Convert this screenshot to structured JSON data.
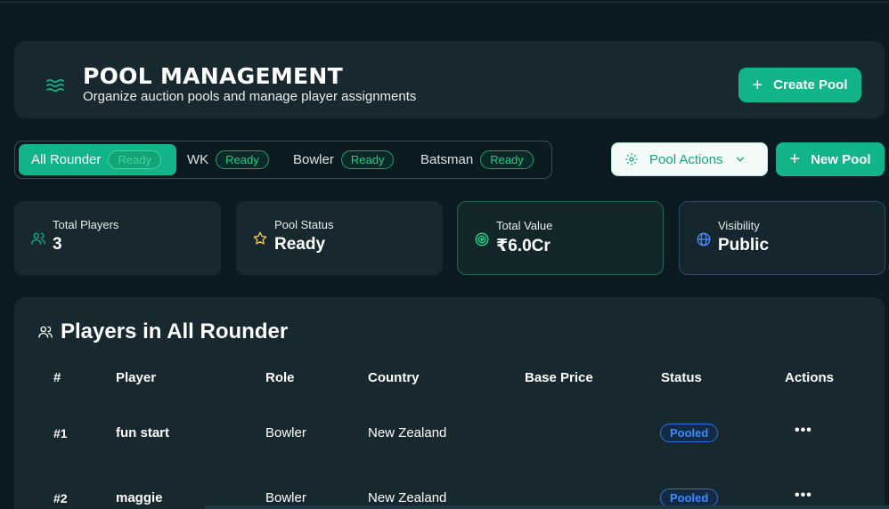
{
  "header": {
    "title": "POOL MANAGEMENT",
    "subtitle": "Organize auction pools and manage player assignments",
    "create_button": "Create Pool",
    "icon": "waves-icon"
  },
  "tabs": [
    {
      "label": "All Rounder",
      "badge": "Ready",
      "active": true
    },
    {
      "label": "WK",
      "badge": "Ready",
      "active": false
    },
    {
      "label": "Bowler",
      "badge": "Ready",
      "active": false
    },
    {
      "label": "Batsman",
      "badge": "Ready",
      "active": false
    }
  ],
  "actions": {
    "pool_actions": "Pool Actions",
    "new_pool": "New Pool"
  },
  "stats": [
    {
      "label": "Total Players",
      "value": "3",
      "icon": "users-icon"
    },
    {
      "label": "Pool Status",
      "value": "Ready",
      "icon": "star-icon"
    },
    {
      "label": "Total Value",
      "value": "₹6.0Cr",
      "icon": "target-icon"
    },
    {
      "label": "Visibility",
      "value": "Public",
      "icon": "globe-icon"
    }
  ],
  "table": {
    "title": "Players in All Rounder",
    "columns": [
      "#",
      "Player",
      "Role",
      "Country",
      "Base Price",
      "Status",
      "Actions"
    ],
    "rows": [
      {
        "num": "#1",
        "player": "fun start",
        "role": "Bowler",
        "country": "New Zealand",
        "base_price": "",
        "status": "Pooled"
      },
      {
        "num": "#2",
        "player": "maggie",
        "role": "Bowler",
        "country": "New Zealand",
        "base_price": "",
        "status": "Pooled"
      }
    ]
  },
  "colors": {
    "accent": "#12b48a",
    "background": "#0c1a21",
    "card": "#17282f",
    "status_blue": "#3d8bff"
  }
}
